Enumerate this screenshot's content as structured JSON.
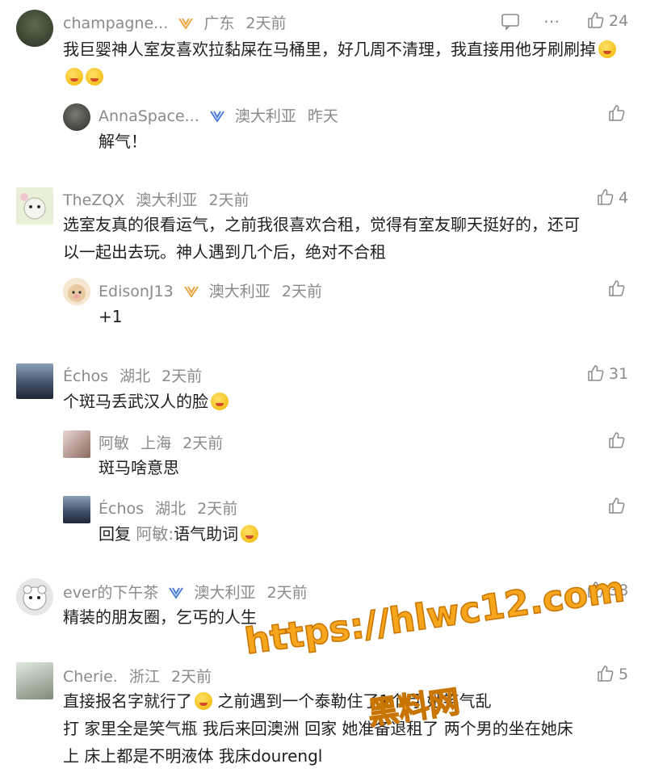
{
  "comments": [
    {
      "name": "champagne...",
      "location": "广东",
      "time": "2天前",
      "likes": "24",
      "text": "我巨婴神人室友喜欢拉黏屎在马桶里，好几周不清理，我直接用他牙刷刷掉",
      "replies": [
        {
          "name": "AnnaSpace...",
          "location": "澳大利亚",
          "time": "昨天",
          "text": "解气！"
        }
      ]
    },
    {
      "name": "TheZQX",
      "location": "澳大利亚",
      "time": "2天前",
      "likes": "4",
      "text_line1": "选室友真的很看运气，之前我很喜欢合租，觉得有室友聊天挺好的，还可",
      "text_line2": "以一起出去玩。神人遇到几个后，绝对不合租",
      "replies": [
        {
          "name": "EdisonJ13",
          "location": "澳大利亚",
          "time": "2天前",
          "text": "+1"
        }
      ]
    },
    {
      "name": "Échos",
      "location": "湖北",
      "time": "2天前",
      "likes": "31",
      "text": "个斑马丢武汉人的脸",
      "replies": [
        {
          "name": "阿敏",
          "location": "上海",
          "time": "2天前",
          "text": "斑马啥意思"
        },
        {
          "name": "Échos",
          "location": "湖北",
          "time": "2天前",
          "reply_prefix": "回复",
          "reply_to": "阿敏:",
          "text": "语气助词"
        }
      ]
    },
    {
      "name": "ever的下午茶",
      "location": "澳大利亚",
      "time": "2天前",
      "likes": "38",
      "text": "精装的朋友圈，乞丐的人生"
    },
    {
      "name": "Cherie.",
      "location": "浙江",
      "time": "2天前",
      "likes": "5",
      "text_line1": "直接报名字就行了",
      "text_line1b": "之前遇到一个泰勒",
      "text_line1c": "住了1个月 她笑气乱",
      "text_line2": "打 家里全是笑气瓶 我后来回澳洲 回家 她准备退租了 两个男的坐在她床",
      "text_line3": "上 床上都是不明液体 我床dourengl"
    }
  ],
  "watermark": {
    "url": "https://hlwc12.com",
    "site": "黑料网"
  },
  "colors": {
    "meta": "#8a8a8a",
    "text": "#1f1f1f",
    "vip_gold": "#e8a640",
    "vip_blue": "#4a7bd8",
    "watermark": "#f7a51c"
  }
}
